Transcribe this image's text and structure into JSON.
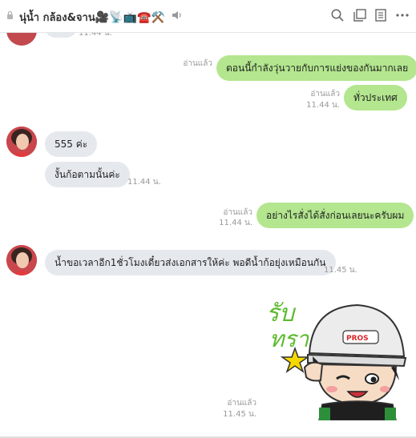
{
  "header": {
    "title": "นุ่น้ำ กล้อง&จาน",
    "title_emojis": "🎥📡📺☎️⚒️"
  },
  "messages": {
    "m0_time": "11.44 น.",
    "m1_read": "อ่านแล้ว",
    "m1_text": "ตอนนี้กำลังวุ่นวายกับการแย่งของกันมากเลย",
    "m2_read": "อ่านแล้ว",
    "m2_time": "11.44 น.",
    "m2_text": "ทั่วประเทศ",
    "m3_text": "555 ค่ะ",
    "m4_text": "งั้นก้อตามนั้นค่ะ",
    "m4_time": "11.44 น.",
    "m5_read": "อ่านแล้ว",
    "m5_time": "11.44 น.",
    "m5_text": "อย่างไรสั่งได้สั่งก่อนเลยนะครับผม",
    "m6_text": "น้ำขอเวลาอีก1ชั่วโมงเดี๋ยวส่งเอกสารให้ค่ะ  พอดีน้ำก้อยุ่งเหมือนกัน",
    "m6_time": "11.45 น.",
    "m7_read": "อ่านแล้ว",
    "m7_time": "11.45 น.",
    "sticker_text": "รับทราบ",
    "sticker_badge": "PROS"
  },
  "colors": {
    "incoming_bubble": "#e5e9ee",
    "outgoing_bubble": "#b3e68e",
    "meta_text": "#999999"
  },
  "icons": [
    "lock-icon",
    "speaker-icon",
    "search-icon",
    "note-icon",
    "album-icon",
    "more-icon"
  ]
}
